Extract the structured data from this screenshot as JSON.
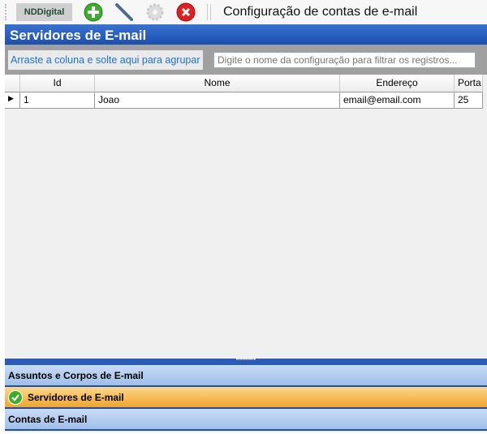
{
  "toolbar": {
    "logo": "NDDigital",
    "title": "Configuração de contas de e-mail",
    "buttons": [
      "add-icon",
      "edit-icon",
      "settings-icon",
      "delete-icon"
    ]
  },
  "panel": {
    "title": "Servidores de E-mail",
    "group_hint": "Arraste a coluna e solte aqui para agrupar",
    "filter_placeholder": "Digite o nome da configuração para filtrar os registros..."
  },
  "grid": {
    "columns": [
      "Id",
      "Nome",
      "Endereço",
      "Porta"
    ],
    "rows": [
      {
        "id": "1",
        "nome": "Joao",
        "endereco": "email@email.com",
        "porta": "25"
      }
    ]
  },
  "accordion": [
    {
      "label": "Assuntos e Corpos de E-mail"
    },
    {
      "label": "Servidores de E-mail",
      "selected": true
    },
    {
      "label": "Contas de E-mail"
    }
  ],
  "colors": {
    "accent": "#1c4fb0",
    "selected": "#f1a42c"
  }
}
